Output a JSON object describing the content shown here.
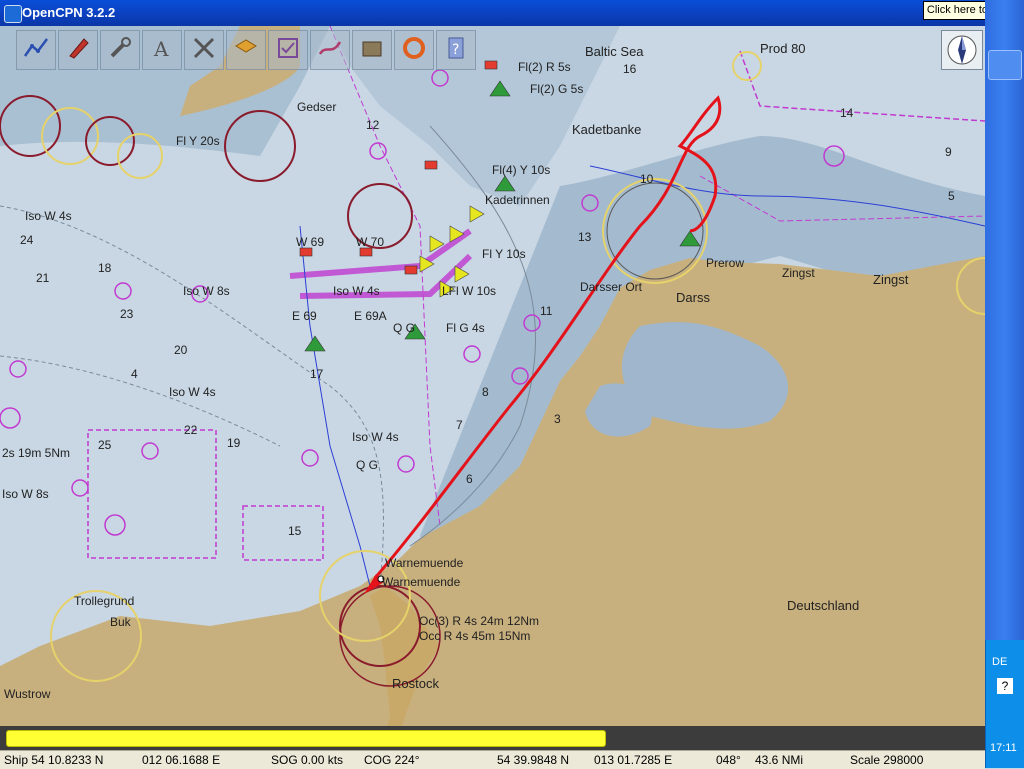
{
  "window": {
    "title": "OpenCPN 3.2.2",
    "tip": "Click here to begin"
  },
  "toolbar": {
    "tools": [
      "route-icon",
      "ship-icon",
      "wrench-icon",
      "font-icon",
      "tide-icon",
      "layers-icon",
      "checklist-icon",
      "track-icon",
      "chart-stack-icon",
      "lifebuoy-icon",
      "help-icon"
    ]
  },
  "chart": {
    "places": [
      {
        "name": "baltic",
        "text": "Baltic Sea"
      },
      {
        "name": "prod",
        "text": "Prod 80"
      },
      {
        "name": "kadetbanke",
        "text": "Kadetbanke"
      },
      {
        "name": "darss",
        "text": "Darss"
      },
      {
        "name": "prerow",
        "text": "Prerow"
      },
      {
        "name": "zingst-town",
        "text": "Zingst"
      },
      {
        "name": "zingst",
        "text": "Zingst"
      },
      {
        "name": "deutschland",
        "text": "Deutschland"
      },
      {
        "name": "rostock",
        "text": "Rostock"
      },
      {
        "name": "warnemuende",
        "text": "Warnemuende"
      },
      {
        "name": "warnemuende2",
        "text": "Warnemuende"
      },
      {
        "name": "bukt",
        "text": "Buk"
      },
      {
        "name": "trollegrund",
        "text": "Trollegrund"
      },
      {
        "name": "wustrow",
        "text": "Wustrow"
      },
      {
        "name": "gedser",
        "text": "Gedser"
      },
      {
        "name": "darsser-ort",
        "text": "Darsser Ort"
      },
      {
        "name": "kadetrinnen",
        "text": "Kadetrinnen"
      }
    ],
    "lights": [
      {
        "name": "lt1",
        "text": "Fl(2) R 5s"
      },
      {
        "name": "lt2",
        "text": "Fl(2) G 5s"
      },
      {
        "name": "lt3",
        "text": "Fl(4) Y 10s"
      },
      {
        "name": "lt4",
        "text": "Iso W 4s"
      },
      {
        "name": "lt5",
        "text": "Iso W 8s"
      },
      {
        "name": "lt6",
        "text": "Iso W 4s"
      },
      {
        "name": "lt7",
        "text": "Iso W 4s"
      },
      {
        "name": "lt8",
        "text": "Iso W 4s"
      },
      {
        "name": "lt9",
        "text": "Iso W 8s"
      },
      {
        "name": "lt10",
        "text": "LFl W 10s"
      },
      {
        "name": "lt11",
        "text": "Q G"
      },
      {
        "name": "lt12",
        "text": "Fl G 4s"
      },
      {
        "name": "lt13",
        "text": "Q G"
      },
      {
        "name": "lt14",
        "text": "Oc(3) R 4s 24m 12Nm"
      },
      {
        "name": "lt15",
        "text": "Occ R 4s 45m 15Nm"
      },
      {
        "name": "lt16",
        "text": "2s 19m 5Nm"
      },
      {
        "name": "lt17",
        "text": "E 69"
      },
      {
        "name": "lt18",
        "text": "E 69A"
      },
      {
        "name": "lt19",
        "text": "W 69"
      },
      {
        "name": "lt20",
        "text": "W 70"
      },
      {
        "name": "lt21",
        "text": "Fl Y 10s"
      },
      {
        "name": "lt22",
        "text": "Fl Y 20s"
      }
    ],
    "soundings": [
      "16",
      "14",
      "10",
      "12",
      "9",
      "18",
      "21",
      "20",
      "17",
      "22",
      "24",
      "25",
      "23",
      "19",
      "15",
      "13",
      "11",
      "8",
      "7",
      "6",
      "5",
      "4",
      "3"
    ]
  },
  "status": {
    "ship": "Ship 54 10.8233 N",
    "lon": "012 06.1688 E",
    "sog": "SOG 0.00 kts",
    "cog": "COG 224°",
    "cursor_lat": "54 39.9848 N",
    "cursor_lon": "013 01.7285 E",
    "bearing": "048°",
    "dist": "43.6 NMi",
    "scale": "Scale 298000",
    "progress": 0.615
  },
  "taskbar": {
    "lang": "DE",
    "help": "?",
    "time": "17:11"
  },
  "colors": {
    "sea": "#c9d7e4",
    "shallow": "#9fb6cc",
    "land": "#c8b07e",
    "route": "#e4131b",
    "magenta": "#c13ad0"
  }
}
